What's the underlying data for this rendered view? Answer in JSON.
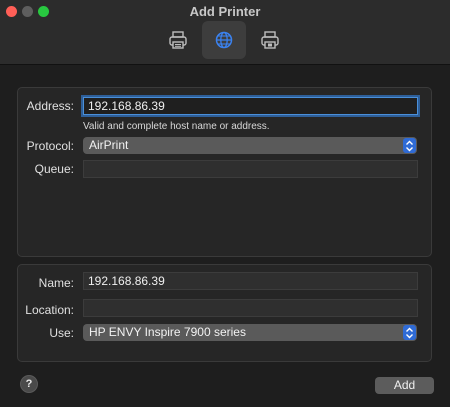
{
  "window": {
    "title": "Add Printer"
  },
  "toolbar": {
    "items": [
      {
        "icon": "printer-icon",
        "selected": false
      },
      {
        "icon": "globe-icon",
        "selected": true
      },
      {
        "icon": "windows-printer-icon",
        "selected": false
      }
    ],
    "accent": "#2f6bd6"
  },
  "form": {
    "address_label": "Address:",
    "address_value": "192.168.86.39",
    "address_hint": "Valid and complete host name or address.",
    "protocol_label": "Protocol:",
    "protocol_value": "AirPrint",
    "queue_label": "Queue:",
    "queue_value": "",
    "name_label": "Name:",
    "name_value": "192.168.86.39",
    "location_label": "Location:",
    "location_value": "",
    "use_label": "Use:",
    "use_value": "HP ENVY Inspire 7900 series"
  },
  "footer": {
    "help_label": "?",
    "add_label": "Add"
  }
}
